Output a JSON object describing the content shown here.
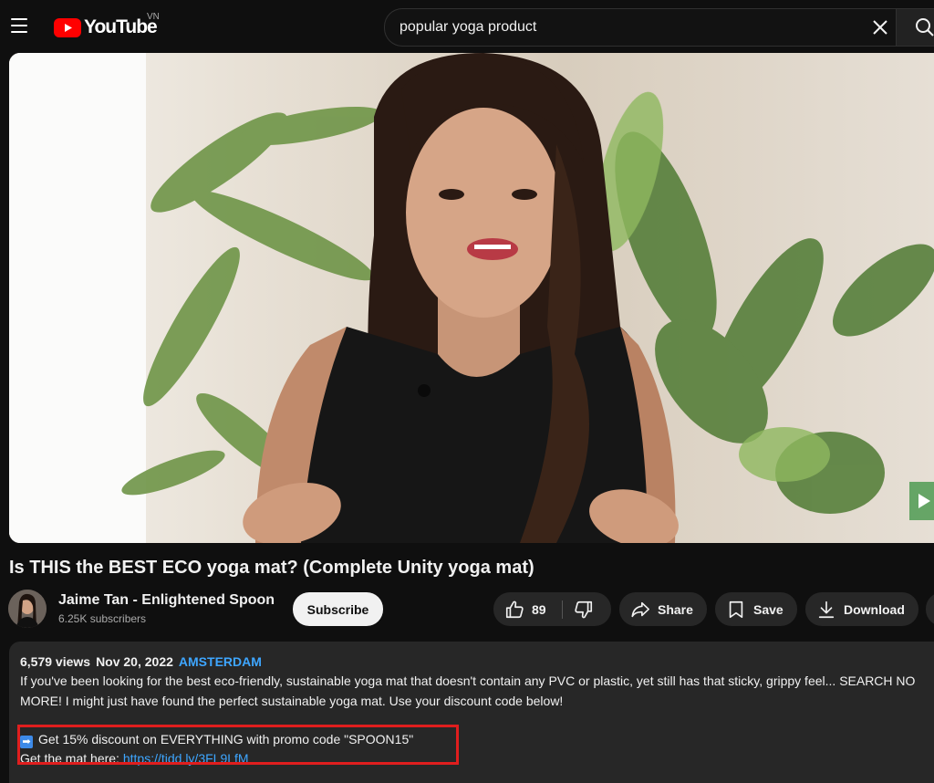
{
  "header": {
    "logo_text": "YouTube",
    "country_code": "VN",
    "search_value": "popular yoga product"
  },
  "video": {
    "title": "Is THIS the BEST ECO yoga mat? (Complete Unity yoga mat)"
  },
  "channel": {
    "name": "Jaime Tan - Enlightened Spoon",
    "subscribers": "6.25K subscribers",
    "subscribe_label": "Subscribe"
  },
  "actions": {
    "like_count": "89",
    "share_label": "Share",
    "save_label": "Save",
    "download_label": "Download"
  },
  "description": {
    "views": "6,579 views",
    "date": "Nov 20, 2022",
    "location": "AMSTERDAM",
    "line1": "If you've been looking for the best eco-friendly, sustainable yoga mat that doesn't contain any PVC or plastic, yet still has that sticky, grippy feel... SEARCH NO",
    "line2": "MORE! I might just have found the perfect sustainable yoga mat. Use your discount code below!",
    "promo_text": "Get 15% discount on EVERYTHING with promo code \"SPOON15\"",
    "mat_prefix": "Get the mat here:",
    "mat_link": "https://tidd.ly/3FL9LfM"
  },
  "colors": {
    "background": "#0f0f0f",
    "surface": "#272727",
    "link": "#3ea6ff",
    "brand_red": "#ff0000",
    "highlight_box": "#e01e1e"
  },
  "icons": [
    "menu-icon",
    "youtube-logo",
    "clear-icon",
    "search-icon",
    "like-icon",
    "dislike-icon",
    "share-icon",
    "save-icon",
    "download-icon",
    "arrow-emoji-icon"
  ]
}
